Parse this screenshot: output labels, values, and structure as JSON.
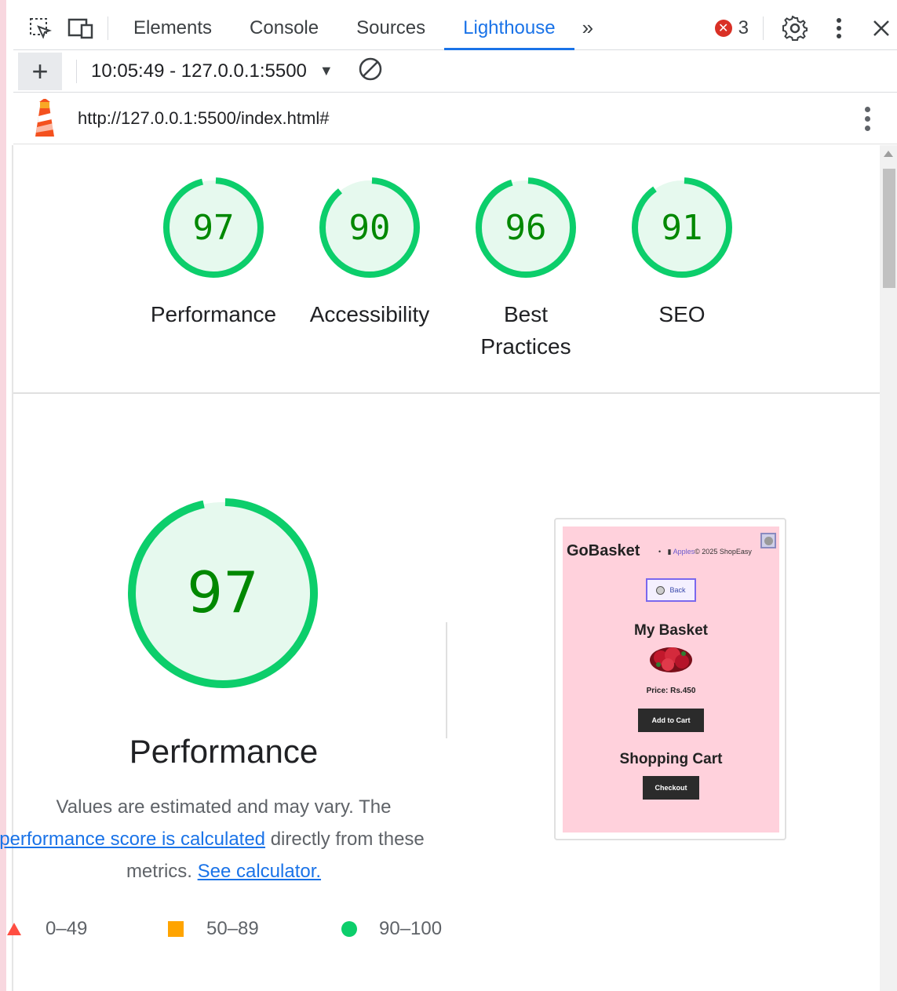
{
  "toolbar": {
    "tabs": [
      {
        "label": "Elements"
      },
      {
        "label": "Console"
      },
      {
        "label": "Sources"
      },
      {
        "label": "Lighthouse"
      }
    ],
    "more_tabs_label": "»",
    "error_count": "3"
  },
  "report_bar": {
    "add_label": "+",
    "selected_report": "10:05:49 - 127.0.0.1:5500"
  },
  "url_row": {
    "url": "http://127.0.0.1:5500/index.html#"
  },
  "scores": [
    {
      "label": "Performance",
      "score": "97",
      "value": 97
    },
    {
      "label": "Accessibility",
      "score": "90",
      "value": 90
    },
    {
      "label": "Best Practices",
      "score": "96",
      "value": 96
    },
    {
      "label": "SEO",
      "score": "91",
      "value": 91
    }
  ],
  "performance": {
    "score": "97",
    "value": 97,
    "title": "Performance",
    "desc_part1": "Values are estimated and may vary. The",
    "link1": "performance score is calculated",
    "desc_part2": "directly from these",
    "desc_part3": "metrics.",
    "link2": "See calculator.",
    "legend": [
      {
        "range": "0–49",
        "color": "#ff4e42",
        "shape": "triangle"
      },
      {
        "range": "50–89",
        "color": "#ffa400",
        "shape": "square"
      },
      {
        "range": "90–100",
        "color": "#0cce6b",
        "shape": "circle"
      }
    ]
  },
  "screenshot": {
    "brand": "GoBasket",
    "nav_bullet": "•",
    "nav_link": "Apples",
    "nav_rest": "© 2025 ShopEasy",
    "back_label": "Back",
    "basket_heading": "My Basket",
    "price": "Price: Rs.450",
    "add_to_cart": "Add to Cart",
    "cart_heading": "Shopping Cart",
    "checkout": "Checkout"
  },
  "colors": {
    "pass_green": "#0cce6b",
    "pass_text": "#008800",
    "pass_fill": "#e6f9ee",
    "accent": "#1a73e8",
    "error": "#d93025",
    "thumb_bg": "#ffd1dc"
  }
}
